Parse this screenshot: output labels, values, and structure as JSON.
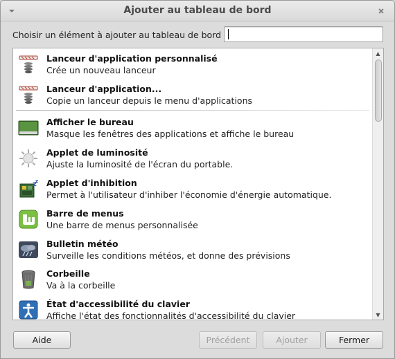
{
  "window": {
    "title": "Ajouter au tableau de bord",
    "menu_icon": "chevron-down-icon",
    "close_icon": "close-icon"
  },
  "prompt": {
    "label": "Choisir un élément à ajouter au tableau de bord :",
    "value": ""
  },
  "items": [
    {
      "name": "Lanceur d'application personnalisé",
      "desc": "Crée un nouveau lanceur",
      "icon": "launcher-icon"
    },
    {
      "name": "Lanceur d'application...",
      "desc": "Copie un lanceur depuis le menu d'applications",
      "icon": "launcher-icon"
    },
    {
      "name": "Afficher le bureau",
      "desc": "Masque les fenêtres des applications et affiche le bureau",
      "icon": "desktop-icon"
    },
    {
      "name": "Applet de luminosité",
      "desc": "Ajuste la luminosité de l'écran du portable.",
      "icon": "brightness-icon"
    },
    {
      "name": "Applet d'inhibition",
      "desc": "Permet à l'utilisateur d'inhiber l'économie d'énergie automatique.",
      "icon": "inhibit-icon"
    },
    {
      "name": "Barre de menus",
      "desc": "Une barre de menus personnalisée",
      "icon": "mint-logo-icon"
    },
    {
      "name": "Bulletin météo",
      "desc": "Surveille les conditions météos, et donne des prévisions",
      "icon": "weather-icon"
    },
    {
      "name": "Corbeille",
      "desc": "Va à la corbeille",
      "icon": "trash-icon"
    },
    {
      "name": "État d'accessibilité du clavier",
      "desc": "Affiche l'état des fonctionnalités d'accessibilité du clavier",
      "icon": "accessibility-icon"
    }
  ],
  "buttons": {
    "help": "Aide",
    "previous": "Précédent",
    "add": "Ajouter",
    "close": "Fermer"
  }
}
